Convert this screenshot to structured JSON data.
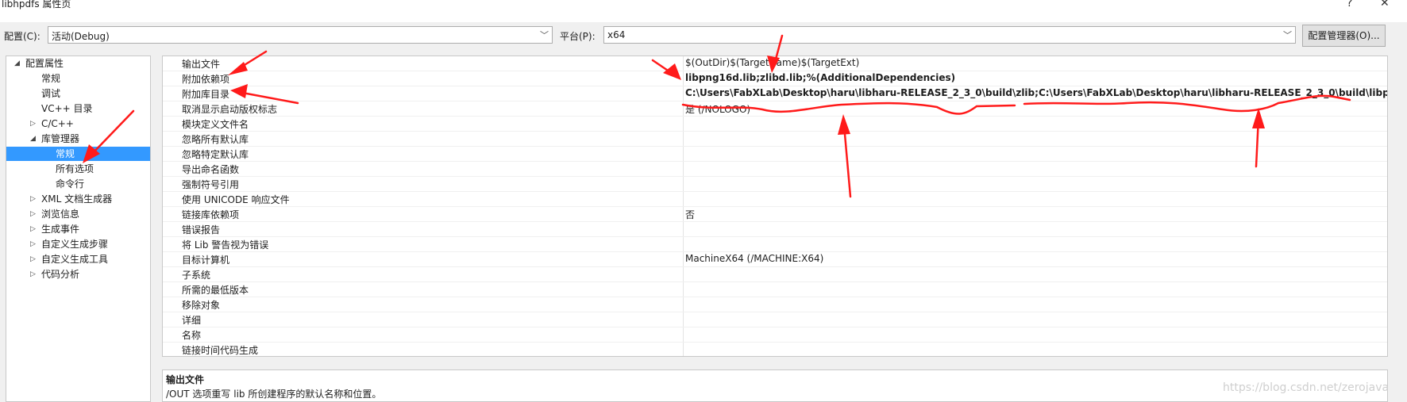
{
  "window": {
    "title": "libhpdfs 属性页",
    "help_glyph": "?",
    "close_glyph": "✕"
  },
  "toolbar": {
    "config_label": "配置(C):",
    "config_value": "活动(Debug)",
    "platform_label": "平台(P):",
    "platform_value": "x64",
    "manager_button": "配置管理器(O)..."
  },
  "tree": {
    "items": [
      {
        "label": "配置属性",
        "expander": "◢"
      },
      {
        "label": "常规",
        "expander": ""
      },
      {
        "label": "调试",
        "expander": ""
      },
      {
        "label": "VC++ 目录",
        "expander": ""
      },
      {
        "label": "C/C++",
        "expander": "▷"
      },
      {
        "label": "库管理器",
        "expander": "◢"
      },
      {
        "label": "常规",
        "expander": ""
      },
      {
        "label": "所有选项",
        "expander": ""
      },
      {
        "label": "命令行",
        "expander": ""
      },
      {
        "label": "XML 文档生成器",
        "expander": "▷"
      },
      {
        "label": "浏览信息",
        "expander": "▷"
      },
      {
        "label": "生成事件",
        "expander": "▷"
      },
      {
        "label": "自定义生成步骤",
        "expander": "▷"
      },
      {
        "label": "自定义生成工具",
        "expander": "▷"
      },
      {
        "label": "代码分析",
        "expander": "▷"
      }
    ]
  },
  "grid": {
    "rows": [
      {
        "name": "输出文件",
        "value": "$(OutDir)$(TargetName)$(TargetExt)"
      },
      {
        "name": "附加依赖项",
        "value": "libpng16d.lib;zlibd.lib;%(AdditionalDependencies)"
      },
      {
        "name": "附加库目录",
        "value": "C:\\Users\\FabXLab\\Desktop\\haru\\libharu-RELEASE_2_3_0\\build\\zlib;C:\\Users\\FabXLab\\Desktop\\haru\\libharu-RELEASE_2_3_0\\build\\libpng;%(Addit"
      },
      {
        "name": "取消显示启动版权标志",
        "value": "是 (/NOLOGO)"
      },
      {
        "name": "模块定义文件名",
        "value": ""
      },
      {
        "name": "忽略所有默认库",
        "value": ""
      },
      {
        "name": "忽略特定默认库",
        "value": ""
      },
      {
        "name": "导出命名函数",
        "value": ""
      },
      {
        "name": "强制符号引用",
        "value": ""
      },
      {
        "name": "使用 UNICODE 响应文件",
        "value": ""
      },
      {
        "name": "链接库依赖项",
        "value": "否"
      },
      {
        "name": "错误报告",
        "value": ""
      },
      {
        "name": "将 Lib 警告视为错误",
        "value": ""
      },
      {
        "name": "目标计算机",
        "value": "MachineX64 (/MACHINE:X64)"
      },
      {
        "name": "子系统",
        "value": ""
      },
      {
        "name": "所需的最低版本",
        "value": ""
      },
      {
        "name": "移除对象",
        "value": ""
      },
      {
        "name": "详细",
        "value": ""
      },
      {
        "name": "名称",
        "value": ""
      },
      {
        "name": "链接时间代码生成",
        "value": ""
      }
    ]
  },
  "description": {
    "title": "输出文件",
    "text": "/OUT 选项重写 lib 所创建程序的默认名称和位置。"
  },
  "watermark": "https://blog.csdn.net/zerojava",
  "annotation_color": "#ff1a1a"
}
